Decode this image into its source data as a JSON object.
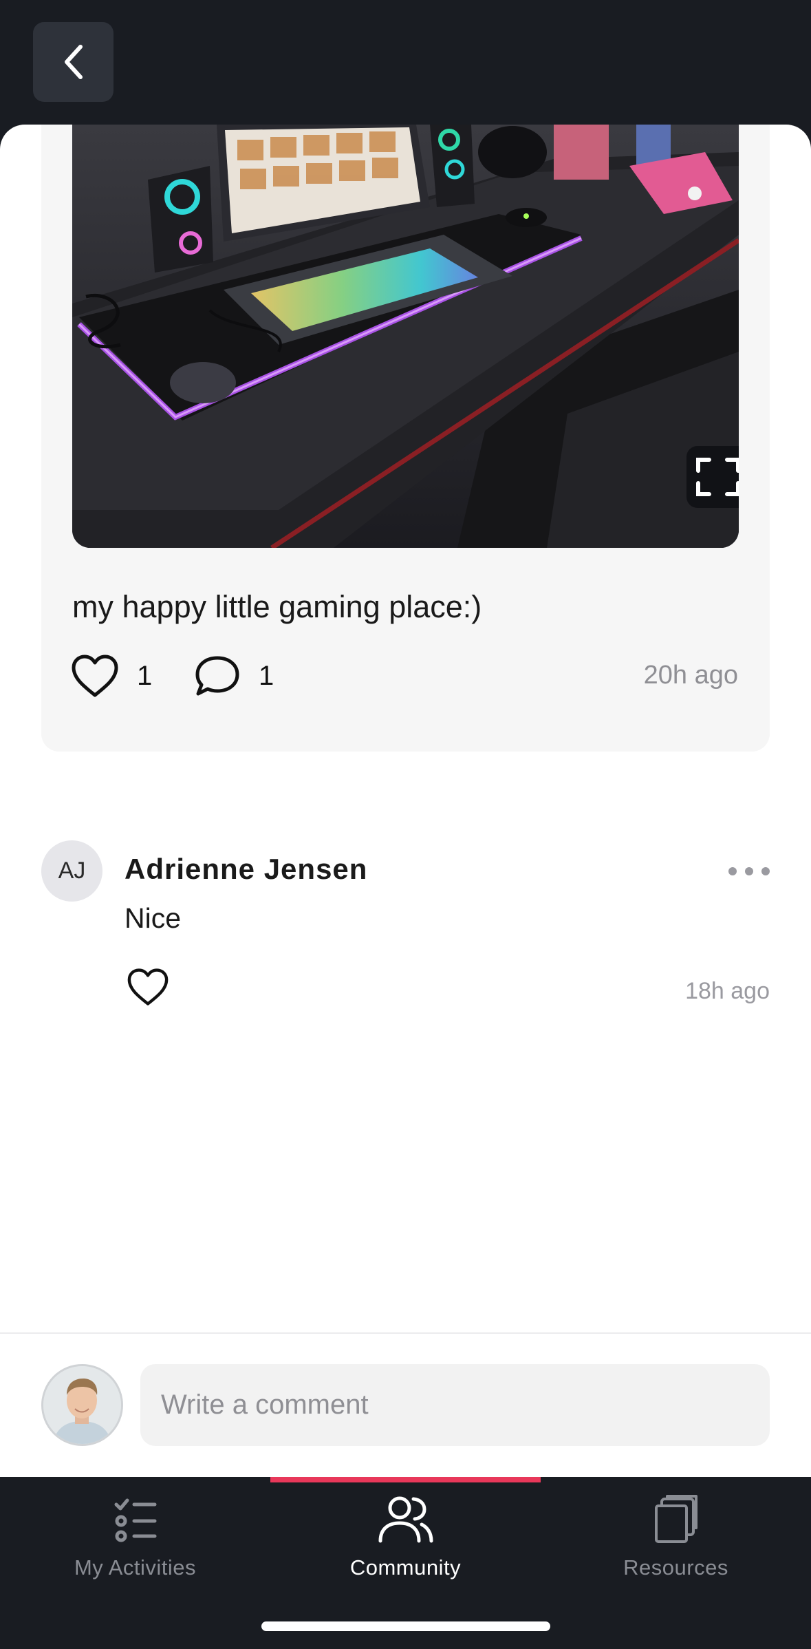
{
  "post": {
    "caption": "my happy little gaming place:)",
    "like_count": "1",
    "comment_count": "1",
    "time": "20h ago",
    "icons": {
      "like": "heart-icon",
      "comment": "speech-bubble-icon",
      "expand": "expand-icon"
    }
  },
  "comment": {
    "initials": "AJ",
    "author": "Adrienne Jensen",
    "text": "Nice",
    "time": "18h ago",
    "icons": {
      "like": "heart-icon",
      "more": "ellipsis-icon"
    }
  },
  "composer": {
    "placeholder": "Write a comment"
  },
  "tabs": [
    {
      "label": "My Activities",
      "icon": "checklist-icon",
      "active": false
    },
    {
      "label": "Community",
      "icon": "people-icon",
      "active": true
    },
    {
      "label": "Resources",
      "icon": "documents-icon",
      "active": false
    }
  ],
  "colors": {
    "dark_background": "#191c22",
    "accent": "#e8385a",
    "muted_text": "#8f8f94"
  }
}
